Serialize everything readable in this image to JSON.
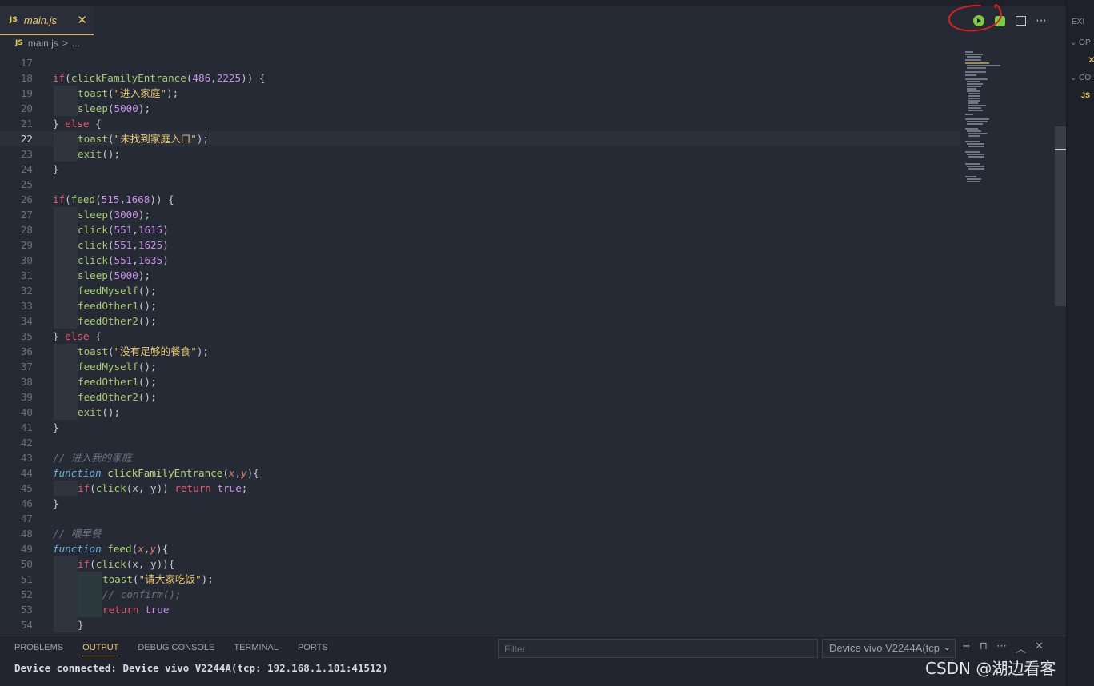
{
  "tab": {
    "badge": "JS",
    "title": "main.js",
    "close": "✕"
  },
  "breadcrumb": {
    "badge": "JS",
    "file": "main.js",
    "sep": ">",
    "more": "..."
  },
  "sidebar": {
    "explorer": "EXI",
    "open": "OP",
    "close_mark": "✕",
    "second": "CO",
    "js": "JS"
  },
  "editor": {
    "current_line": 22
  },
  "panel": {
    "tabs": [
      "PROBLEMS",
      "OUTPUT",
      "DEBUG CONSOLE",
      "TERMINAL",
      "PORTS"
    ],
    "active_tab": "OUTPUT",
    "filter_placeholder": "Filter",
    "device_select": "Device vivo V2244A(tcp",
    "output": "Device connected: Device vivo V2244A(tcp: 192.168.1.101:41512)"
  },
  "watermark": "CSDN @湖边看客",
  "icons": [
    "run-icon",
    "debug-icon",
    "split-editor-icon",
    "more-icon",
    "list-filter-icon",
    "lock-icon",
    "ellipsis-icon",
    "chevron-up-icon",
    "close-icon"
  ]
}
